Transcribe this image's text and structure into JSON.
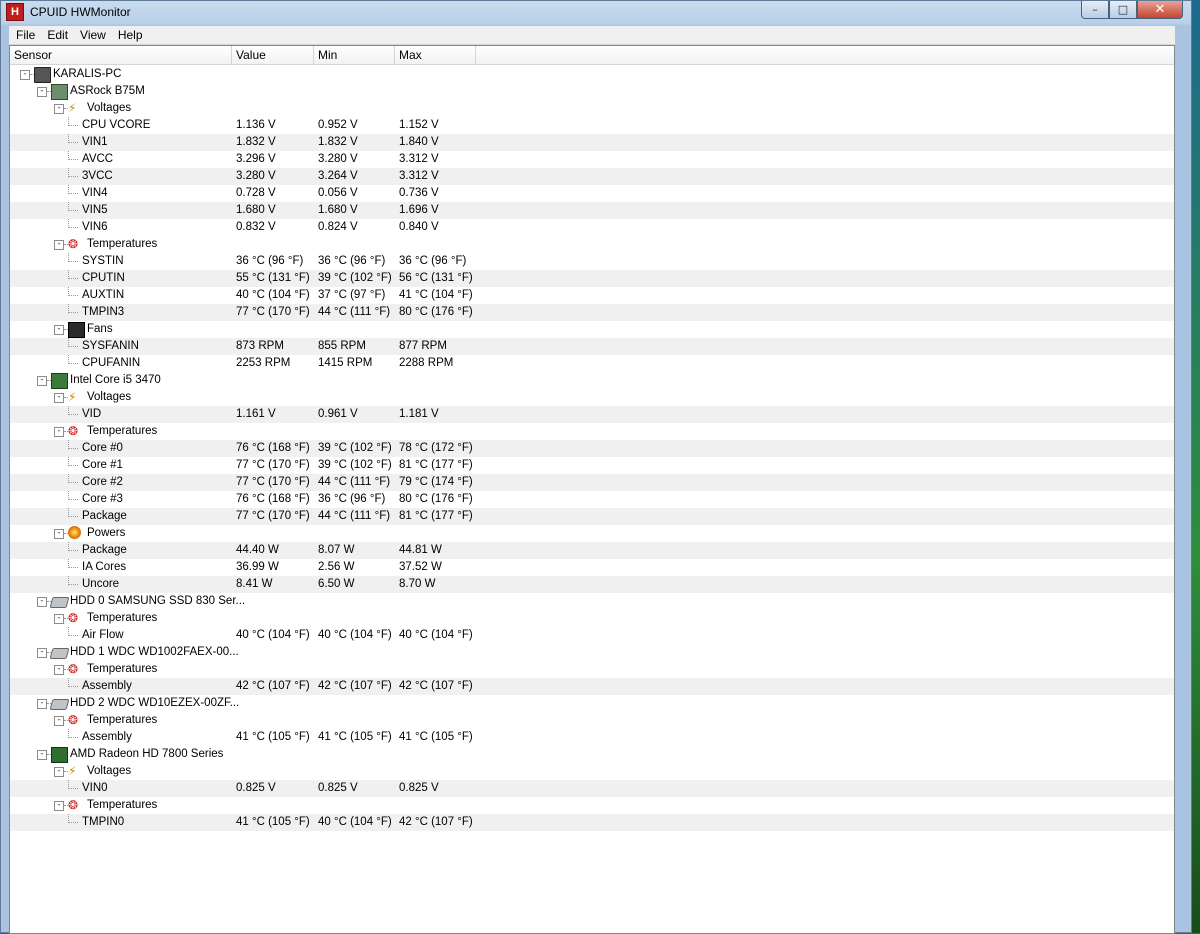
{
  "window": {
    "title": "CPUID HWMonitor",
    "icon_letter": "H"
  },
  "menu": [
    "File",
    "Edit",
    "View",
    "Help"
  ],
  "columns": [
    "Sensor",
    "Value",
    "Min",
    "Max"
  ],
  "rows": [
    {
      "depth": 0,
      "icon": "computer-icon",
      "label": "KARALIS-PC",
      "expander": "-"
    },
    {
      "depth": 1,
      "icon": "motherboard-icon",
      "label": "ASRock B75M",
      "expander": "-"
    },
    {
      "depth": 2,
      "icon": "voltage-icon",
      "label": "Voltages",
      "expander": "-"
    },
    {
      "depth": 3,
      "label": "CPU VCORE",
      "value": "1.136 V",
      "min": "0.952 V",
      "max": "1.152 V"
    },
    {
      "depth": 3,
      "label": "VIN1",
      "value": "1.832 V",
      "min": "1.832 V",
      "max": "1.840 V"
    },
    {
      "depth": 3,
      "label": "AVCC",
      "value": "3.296 V",
      "min": "3.280 V",
      "max": "3.312 V"
    },
    {
      "depth": 3,
      "label": "3VCC",
      "value": "3.280 V",
      "min": "3.264 V",
      "max": "3.312 V"
    },
    {
      "depth": 3,
      "label": "VIN4",
      "value": "0.728 V",
      "min": "0.056 V",
      "max": "0.736 V"
    },
    {
      "depth": 3,
      "label": "VIN5",
      "value": "1.680 V",
      "min": "1.680 V",
      "max": "1.696 V"
    },
    {
      "depth": 3,
      "label": "VIN6",
      "value": "0.832 V",
      "min": "0.824 V",
      "max": "0.840 V"
    },
    {
      "depth": 2,
      "icon": "thermometer-icon",
      "label": "Temperatures",
      "expander": "-"
    },
    {
      "depth": 3,
      "label": "SYSTIN",
      "value": "36 °C  (96 °F)",
      "min": "36 °C  (96 °F)",
      "max": "36 °C  (96 °F)"
    },
    {
      "depth": 3,
      "label": "CPUTIN",
      "value": "55 °C  (131 °F)",
      "min": "39 °C  (102 °F)",
      "max": "56 °C  (131 °F)"
    },
    {
      "depth": 3,
      "label": "AUXTIN",
      "value": "40 °C  (104 °F)",
      "min": "37 °C  (97 °F)",
      "max": "41 °C  (104 °F)"
    },
    {
      "depth": 3,
      "label": "TMPIN3",
      "value": "77 °C  (170 °F)",
      "min": "44 °C  (111 °F)",
      "max": "80 °C  (176 °F)"
    },
    {
      "depth": 2,
      "icon": "fan-icon",
      "label": "Fans",
      "expander": "-"
    },
    {
      "depth": 3,
      "label": "SYSFANIN",
      "value": "873 RPM",
      "min": "855 RPM",
      "max": "877 RPM"
    },
    {
      "depth": 3,
      "label": "CPUFANIN",
      "value": "2253 RPM",
      "min": "1415 RPM",
      "max": "2288 RPM"
    },
    {
      "depth": 1,
      "icon": "cpu-icon",
      "label": "Intel Core i5 3470",
      "expander": "-"
    },
    {
      "depth": 2,
      "icon": "voltage-icon",
      "label": "Voltages",
      "expander": "-"
    },
    {
      "depth": 3,
      "label": "VID",
      "value": "1.161 V",
      "min": "0.961 V",
      "max": "1.181 V"
    },
    {
      "depth": 2,
      "icon": "thermometer-icon",
      "label": "Temperatures",
      "expander": "-"
    },
    {
      "depth": 3,
      "label": "Core #0",
      "value": "76 °C  (168 °F)",
      "min": "39 °C  (102 °F)",
      "max": "78 °C  (172 °F)"
    },
    {
      "depth": 3,
      "label": "Core #1",
      "value": "77 °C  (170 °F)",
      "min": "39 °C  (102 °F)",
      "max": "81 °C  (177 °F)"
    },
    {
      "depth": 3,
      "label": "Core #2",
      "value": "77 °C  (170 °F)",
      "min": "44 °C  (111 °F)",
      "max": "79 °C  (174 °F)"
    },
    {
      "depth": 3,
      "label": "Core #3",
      "value": "76 °C  (168 °F)",
      "min": "36 °C  (96 °F)",
      "max": "80 °C  (176 °F)"
    },
    {
      "depth": 3,
      "label": "Package",
      "value": "77 °C  (170 °F)",
      "min": "44 °C  (111 °F)",
      "max": "81 °C  (177 °F)"
    },
    {
      "depth": 2,
      "icon": "power-icon",
      "label": "Powers",
      "expander": "-"
    },
    {
      "depth": 3,
      "label": "Package",
      "value": "44.40 W",
      "min": "8.07 W",
      "max": "44.81 W"
    },
    {
      "depth": 3,
      "label": "IA Cores",
      "value": "36.99 W",
      "min": "2.56 W",
      "max": "37.52 W"
    },
    {
      "depth": 3,
      "label": "Uncore",
      "value": "8.41 W",
      "min": "6.50 W",
      "max": "8.70 W"
    },
    {
      "depth": 1,
      "icon": "hard-drive-icon",
      "label": "HDD 0 SAMSUNG SSD 830 Ser...",
      "expander": "-"
    },
    {
      "depth": 2,
      "icon": "thermometer-icon",
      "label": "Temperatures",
      "expander": "-"
    },
    {
      "depth": 3,
      "label": "Air Flow",
      "value": "40 °C  (104 °F)",
      "min": "40 °C  (104 °F)",
      "max": "40 °C  (104 °F)"
    },
    {
      "depth": 1,
      "icon": "hard-drive-icon",
      "label": "HDD 1 WDC WD1002FAEX-00...",
      "expander": "-"
    },
    {
      "depth": 2,
      "icon": "thermometer-icon",
      "label": "Temperatures",
      "expander": "-"
    },
    {
      "depth": 3,
      "label": "Assembly",
      "value": "42 °C  (107 °F)",
      "min": "42 °C  (107 °F)",
      "max": "42 °C  (107 °F)"
    },
    {
      "depth": 1,
      "icon": "hard-drive-icon",
      "label": "HDD 2 WDC WD10EZEX-00ZF...",
      "expander": "-"
    },
    {
      "depth": 2,
      "icon": "thermometer-icon",
      "label": "Temperatures",
      "expander": "-"
    },
    {
      "depth": 3,
      "label": "Assembly",
      "value": "41 °C  (105 °F)",
      "min": "41 °C  (105 °F)",
      "max": "41 °C  (105 °F)"
    },
    {
      "depth": 1,
      "icon": "graphics-card-icon",
      "label": "AMD Radeon HD 7800 Series",
      "expander": "-"
    },
    {
      "depth": 2,
      "icon": "voltage-icon",
      "label": "Voltages",
      "expander": "-"
    },
    {
      "depth": 3,
      "label": "VIN0",
      "value": "0.825 V",
      "min": "0.825 V",
      "max": "0.825 V"
    },
    {
      "depth": 2,
      "icon": "thermometer-icon",
      "label": "Temperatures",
      "expander": "-"
    },
    {
      "depth": 3,
      "label": "TMPIN0",
      "value": "41 °C  (105 °F)",
      "min": "40 °C  (104 °F)",
      "max": "42 °C  (107 °F)"
    }
  ]
}
